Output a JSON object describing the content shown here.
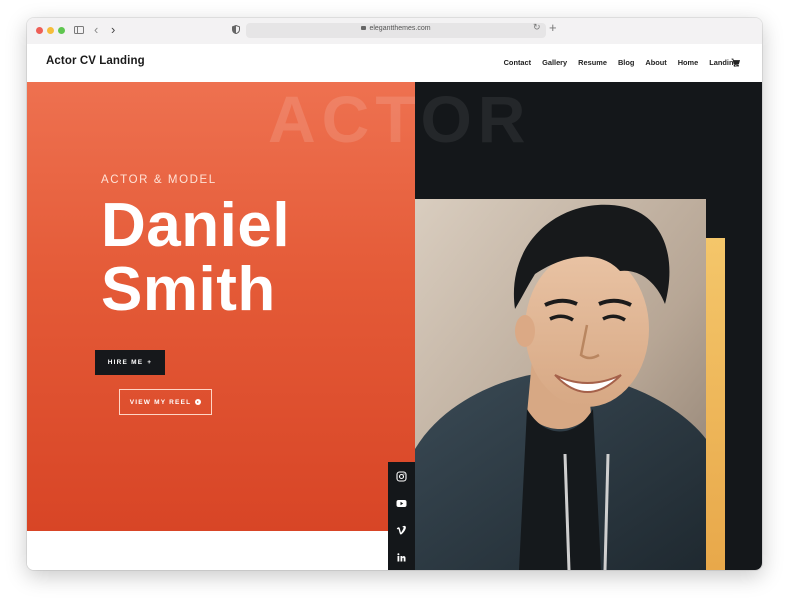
{
  "browser": {
    "url": "elegantthemes.com"
  },
  "header": {
    "logo": "Actor CV Landing",
    "menu": [
      "Contact",
      "Gallery",
      "Resume",
      "Blog",
      "About",
      "Home",
      "Landing"
    ]
  },
  "hero": {
    "watermark": "ACTOR",
    "subtitle": "ACTOR & MODEL",
    "name_line1": "Daniel",
    "name_line2": "Smith",
    "hire_label": "HIRE ME",
    "reel_label": "VIEW MY REEL"
  },
  "colors": {
    "accent": "#e45a37",
    "dark": "#14171a",
    "gold": "#f0b85e"
  },
  "social": [
    "instagram-icon",
    "youtube-icon",
    "vimeo-icon",
    "linkedin-icon"
  ]
}
